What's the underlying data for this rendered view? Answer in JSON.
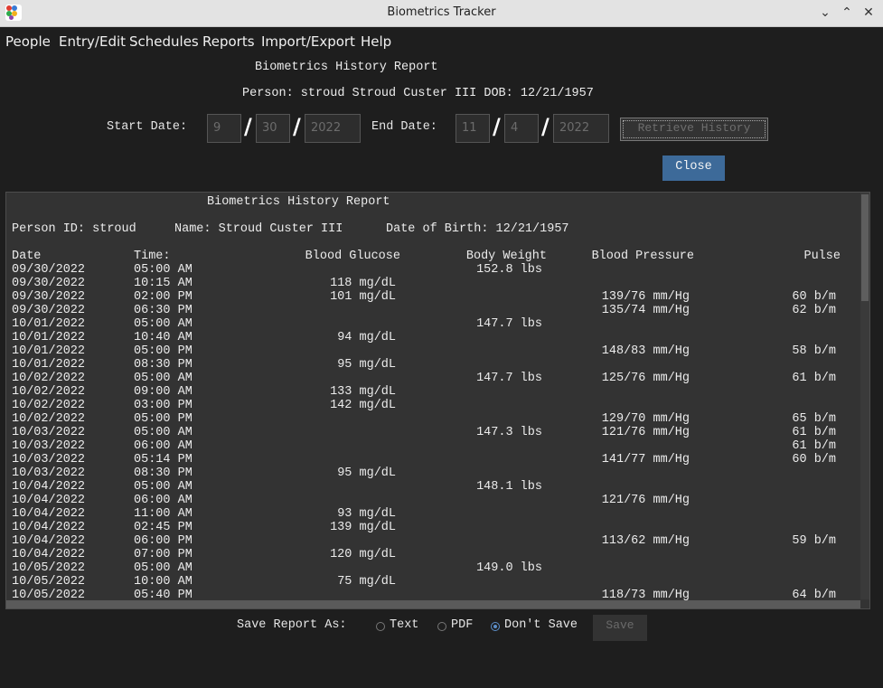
{
  "window": {
    "title": "Biometrics Tracker"
  },
  "menu": [
    "People",
    "Entry/Edit",
    "Schedules",
    "Reports",
    "Import/Export",
    "Help"
  ],
  "form": {
    "title": "Biometrics History Report",
    "person_line": "Person: stroud Stroud Custer III DOB: 12/21/1957",
    "start_label": "Start Date:",
    "end_label": "End Date:",
    "start_month": "9",
    "start_day": "30",
    "start_year": "2022",
    "end_month": "11",
    "end_day": "4",
    "end_year": "2022",
    "slash": "/",
    "retrieve_label": "Retrieve History",
    "close_label": "Close"
  },
  "report": {
    "title": "Biometrics History Report",
    "person_id": "Person ID: stroud",
    "name": "Name: Stroud Custer III",
    "dob": "Date of Birth: 12/21/1957",
    "columns": [
      "Date",
      "Time:",
      "Blood Glucose",
      "Body Weight",
      "Blood Pressure",
      "Pulse"
    ],
    "rows": [
      [
        "09/30/2022",
        "05:00 AM",
        "",
        "152.8 lbs",
        "",
        ""
      ],
      [
        "09/30/2022",
        "10:15 AM",
        "118 mg/dL",
        "",
        "",
        ""
      ],
      [
        "09/30/2022",
        "02:00 PM",
        "101 mg/dL",
        "",
        "139/76 mm/Hg",
        "60 b/m"
      ],
      [
        "09/30/2022",
        "06:30 PM",
        "",
        "",
        "135/74 mm/Hg",
        "62 b/m"
      ],
      [
        "10/01/2022",
        "05:00 AM",
        "",
        "147.7 lbs",
        "",
        ""
      ],
      [
        "10/01/2022",
        "10:40 AM",
        "94 mg/dL",
        "",
        "",
        ""
      ],
      [
        "10/01/2022",
        "05:00 PM",
        "",
        "",
        "148/83 mm/Hg",
        "58 b/m"
      ],
      [
        "10/01/2022",
        "08:30 PM",
        "95 mg/dL",
        "",
        "",
        ""
      ],
      [
        "10/02/2022",
        "05:00 AM",
        "",
        "147.7 lbs",
        "125/76 mm/Hg",
        "61 b/m"
      ],
      [
        "10/02/2022",
        "09:00 AM",
        "133 mg/dL",
        "",
        "",
        ""
      ],
      [
        "10/02/2022",
        "03:00 PM",
        "142 mg/dL",
        "",
        "",
        ""
      ],
      [
        "10/02/2022",
        "05:00 PM",
        "",
        "",
        "129/70 mm/Hg",
        "65 b/m"
      ],
      [
        "10/03/2022",
        "05:00 AM",
        "",
        "147.3 lbs",
        "121/76 mm/Hg",
        "61 b/m"
      ],
      [
        "10/03/2022",
        "06:00 AM",
        "",
        "",
        "",
        "61 b/m"
      ],
      [
        "10/03/2022",
        "05:14 PM",
        "",
        "",
        "141/77 mm/Hg",
        "60 b/m"
      ],
      [
        "10/03/2022",
        "08:30 PM",
        "95 mg/dL",
        "",
        "",
        ""
      ],
      [
        "10/04/2022",
        "05:00 AM",
        "",
        "148.1 lbs",
        "",
        ""
      ],
      [
        "10/04/2022",
        "06:00 AM",
        "",
        "",
        "121/76 mm/Hg",
        ""
      ],
      [
        "10/04/2022",
        "11:00 AM",
        "93 mg/dL",
        "",
        "",
        ""
      ],
      [
        "10/04/2022",
        "02:45 PM",
        "139 mg/dL",
        "",
        "",
        ""
      ],
      [
        "10/04/2022",
        "06:00 PM",
        "",
        "",
        "113/62 mm/Hg",
        "59 b/m"
      ],
      [
        "10/04/2022",
        "07:00 PM",
        "120 mg/dL",
        "",
        "",
        ""
      ],
      [
        "10/05/2022",
        "05:00 AM",
        "",
        "149.0 lbs",
        "",
        ""
      ],
      [
        "10/05/2022",
        "10:00 AM",
        "75 mg/dL",
        "",
        "",
        ""
      ],
      [
        "10/05/2022",
        "05:40 PM",
        "",
        "",
        "118/73 mm/Hg",
        "64 b/m"
      ]
    ]
  },
  "save": {
    "label": "Save Report As:",
    "options": [
      "Text",
      "PDF",
      "Don't Save"
    ],
    "selected": "Don't Save",
    "button_label": "Save"
  },
  "colors": {
    "accent": "#3d6a99",
    "background": "#1e1e1e",
    "report_bg": "#333333"
  }
}
